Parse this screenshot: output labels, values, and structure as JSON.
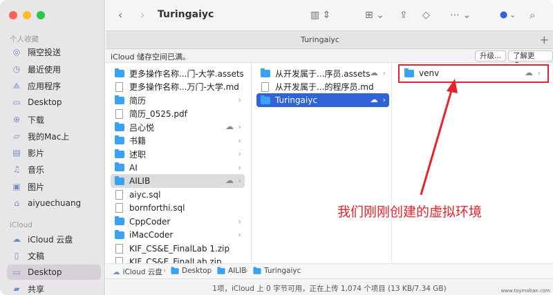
{
  "sidebar": {
    "section_personal": "个人收藏",
    "section_icloud": "iCloud",
    "items": [
      {
        "label": "隔空投送",
        "icon": "airdrop-icon"
      },
      {
        "label": "最近使用",
        "icon": "clock-icon"
      },
      {
        "label": "应用程序",
        "icon": "applications-icon"
      },
      {
        "label": "Desktop",
        "icon": "desktop-icon"
      },
      {
        "label": "下载",
        "icon": "download-icon"
      },
      {
        "label": "我的Mac上",
        "icon": "folder-icon"
      },
      {
        "label": "影片",
        "icon": "film-icon"
      },
      {
        "label": "音乐",
        "icon": "music-icon"
      },
      {
        "label": "图片",
        "icon": "photo-icon"
      },
      {
        "label": "aiyuechuang",
        "icon": "home-icon"
      }
    ],
    "icloud_items": [
      {
        "label": "iCloud 云盘",
        "icon": "icloud-icon"
      },
      {
        "label": "文稿",
        "icon": "document-icon"
      },
      {
        "label": "Desktop",
        "icon": "desktop-icon"
      },
      {
        "label": "共享",
        "icon": "shared-folder-icon"
      }
    ]
  },
  "toolbar": {
    "title": "Turingaiyc"
  },
  "tab": {
    "label": "Turingaiyc",
    "plus": "+"
  },
  "icloud_bar": {
    "message": "iCloud 储存空间已满。",
    "upgrade_label": "升级...",
    "learn_more_label": "了解更多..."
  },
  "column1": [
    {
      "name": "更多操作名称...门-大学.assets",
      "kind": "folder",
      "chevron": true
    },
    {
      "name": "更多操作名称...万门-大学.md",
      "kind": "doc"
    },
    {
      "name": "简历",
      "kind": "folder",
      "chevron": true
    },
    {
      "name": "简历_0525.pdf",
      "kind": "doc"
    },
    {
      "name": "吕心悦",
      "kind": "folder",
      "chevron": true,
      "cloud": true
    },
    {
      "name": "书籍",
      "kind": "folder",
      "chevron": true
    },
    {
      "name": "述职",
      "kind": "folder",
      "chevron": true
    },
    {
      "name": "AI",
      "kind": "folder",
      "chevron": true
    },
    {
      "name": "AILIB",
      "kind": "folder",
      "chevron": true,
      "cloud": true,
      "selected": "dim"
    },
    {
      "name": "aiyc.sql",
      "kind": "doc"
    },
    {
      "name": "bornforthi.sql",
      "kind": "doc"
    },
    {
      "name": "CppCoder",
      "kind": "folder",
      "chevron": true
    },
    {
      "name": "iMacCoder",
      "kind": "folder",
      "chevron": true
    },
    {
      "name": "KIF_CS&E_FinalLab 1.zip",
      "kind": "doc"
    },
    {
      "name": "KIF_CS&E_FinalLab.zip",
      "kind": "doc"
    }
  ],
  "column2": [
    {
      "name": "从开发属于...序员.assets",
      "kind": "folder",
      "chevron": true,
      "cloud": true
    },
    {
      "name": "从开发属于...的程序员.md",
      "kind": "doc"
    },
    {
      "name": "Turingaiyc",
      "kind": "folder",
      "chevron": true,
      "cloud": true,
      "selected": "active"
    }
  ],
  "column3": [
    {
      "name": "venv",
      "kind": "folder",
      "chevron": true,
      "cloud": true
    }
  ],
  "pathbar": [
    "iCloud 云盘",
    "Desktop",
    "AILIB",
    "Turingaiyc"
  ],
  "status": "1项，iCloud 上 0 字节可用，正在上传 1,074 个项目 (13 KB/7.34 GB)",
  "annotation": "我们刚刚创建的虚拟环境",
  "colors": {
    "accent": "#2f63d6",
    "annotation": "#e8222d",
    "folder": "#3ba1f2"
  }
}
